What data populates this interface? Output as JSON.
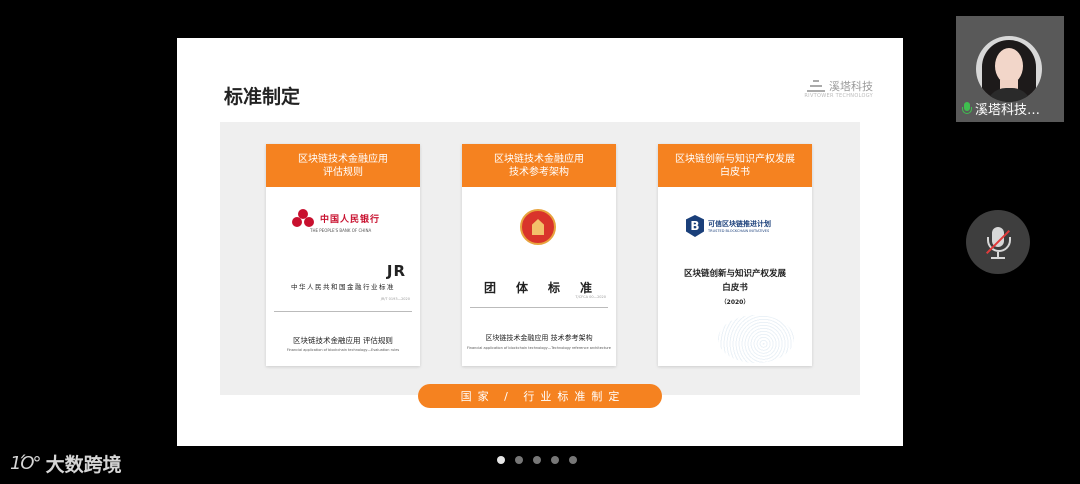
{
  "slide": {
    "title": "标准制定",
    "brand_name": "溪塔科技",
    "brand_sub": "RIVTOWER TECHNOLOGY",
    "footer_label": "国家 / 行业标准制定",
    "cards": [
      {
        "header_line1": "区块链技术金融应用",
        "header_line2": "评估规则",
        "issuer_cn": "中国人民银行",
        "issuer_en": "THE PEOPLE'S BANK OF CHINA",
        "code": "JR",
        "standard_line": "中华人民共和国金融行业标准",
        "standard_no": "JR/T 0193—2020",
        "doc_title": "区块链技术金融应用  评估规则",
        "doc_title_en": "Financial application of blockchain technology—Evaluation rules"
      },
      {
        "header_line1": "区块链技术金融应用",
        "header_line2": "技术参考架构",
        "group_standard": "团体标准",
        "standard_no": "T/CFCA 00—2020",
        "doc_title": "区块链技术金融应用  技术参考架构",
        "doc_title_en": "Financial application of blockchain technology—Technology reference architecture"
      },
      {
        "header_line1": "区块链创新与知识产权发展",
        "header_line2": "白皮书",
        "org_cn": "可信区块链推进计划",
        "org_en": "TRUSTED BLOCKCHAIN INITIATIVES",
        "wp_line1": "区块链创新与知识产权发展",
        "wp_line2": "白皮书",
        "year": "（2020）"
      }
    ]
  },
  "participant": {
    "name": "溪塔科技…"
  },
  "pagination": {
    "total": 5,
    "active": 1
  },
  "watermark": {
    "mark": "1Ό°",
    "text": "大数跨境"
  },
  "colors": {
    "accent": "#f58220",
    "pboc_red": "#c8102e",
    "tbi_blue": "#1a3f7a"
  },
  "icons": [
    "microphone-icon",
    "microphone-muted-icon"
  ]
}
